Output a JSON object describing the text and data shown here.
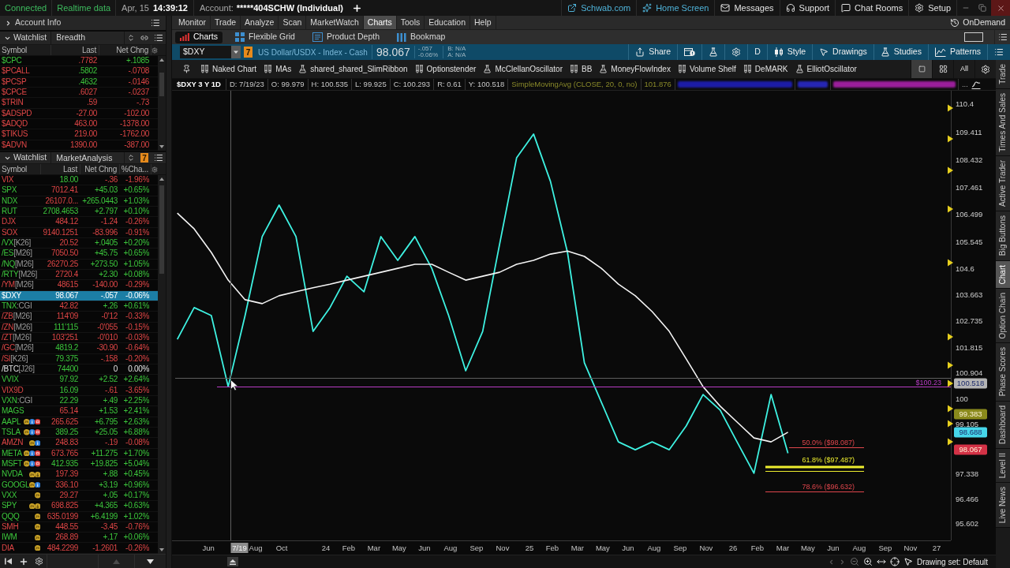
{
  "status_bar": {
    "connection": "Connected",
    "data_feed": "Realtime data",
    "date": "Apr, 15",
    "time": "14:39:12",
    "account_label": "Account:",
    "account": "*****404SCHW (Individual)"
  },
  "top_links": [
    {
      "label": "Schwab.com",
      "kind": "external",
      "accent": true
    },
    {
      "label": "Home Screen",
      "kind": "home",
      "accent": true
    },
    {
      "label": "Messages",
      "kind": "mail",
      "accent": false
    },
    {
      "label": "Support",
      "kind": "support",
      "accent": false
    },
    {
      "label": "Chat Rooms",
      "kind": "chat",
      "accent": false
    },
    {
      "label": "Setup",
      "kind": "setup",
      "accent": false
    }
  ],
  "account_info": {
    "label": "Account Info",
    "expanded": false
  },
  "watchlists": [
    {
      "title": "Watchlist",
      "name": "Breadth",
      "expanded": true,
      "columns": [
        "Symbol",
        "Last",
        "Net Chng"
      ],
      "rows": [
        {
          "symbol": "$CPC",
          "last": ".7782",
          "change": "+.1085",
          "up": true,
          "down": false,
          "last_up": false,
          "selected": false
        },
        {
          "symbol": "$PCALL",
          "last": ".5802",
          "change": "-.0708",
          "up": false,
          "down": true,
          "last_up": true,
          "selected": false
        },
        {
          "symbol": "$PCSP",
          "last": ".4632",
          "change": "-.0146",
          "up": false,
          "down": true,
          "last_up": true,
          "selected": false
        },
        {
          "symbol": "$CPCE",
          "last": ".6027",
          "change": "-.0237",
          "up": false,
          "down": true,
          "last_up": false,
          "selected": false
        },
        {
          "symbol": "$TRIN",
          "last": ".59",
          "change": "-.73",
          "up": false,
          "down": true,
          "last_up": false,
          "selected": false
        },
        {
          "symbol": "$ADSPD",
          "last": "-27.00",
          "change": "-102.00",
          "up": false,
          "down": true,
          "last_up": false,
          "selected": false
        },
        {
          "symbol": "$ADQD",
          "last": "463.00",
          "change": "-1378.00",
          "up": false,
          "down": true,
          "last_up": false,
          "selected": false
        },
        {
          "symbol": "$TIKUS",
          "last": "219.00",
          "change": "-1762.00",
          "up": false,
          "down": true,
          "last_up": false,
          "selected": false
        },
        {
          "symbol": "$ADVN",
          "last": "1390.00",
          "change": "-387.00",
          "up": false,
          "down": true,
          "last_up": false,
          "selected": false
        }
      ]
    },
    {
      "title": "Watchlist",
      "name": "MarketAnalysis",
      "expanded": true,
      "link_badge": "7",
      "columns": [
        "Symbol",
        "Last",
        "Net Chng",
        "%Cha..."
      ],
      "rows": [
        {
          "symbol": "VIX",
          "last": "18.00",
          "change": "-.36",
          "percent": "-1.96%",
          "up": false,
          "down": true,
          "last_up": true,
          "selected": false
        },
        {
          "symbol": "SPX",
          "last": "7012.41",
          "change": "+45.03",
          "percent": "+0.65%",
          "up": true,
          "down": false,
          "last_up": false,
          "selected": false
        },
        {
          "symbol": "NDX",
          "last": "26107.0...",
          "change": "+265.0443",
          "percent": "+1.03%",
          "up": true,
          "down": false,
          "last_up": false,
          "selected": false
        },
        {
          "symbol": "RUT",
          "last": "2708.4653",
          "change": "+2.797",
          "percent": "+0.10%",
          "up": true,
          "down": false,
          "last_up": true,
          "selected": false
        },
        {
          "symbol": "DJX",
          "last": "484.12",
          "change": "-1.24",
          "percent": "-0.26%",
          "up": false,
          "down": true,
          "last_up": false,
          "selected": false
        },
        {
          "symbol": "SOX",
          "last": "9140.1251",
          "change": "-83.996",
          "percent": "-0.91%",
          "up": false,
          "down": true,
          "last_up": false,
          "selected": false
        },
        {
          "symbol": "/VX",
          "suffix": "[K26]",
          "last": "20.52",
          "change": "+.0405",
          "percent": "+0.20%",
          "up": true,
          "down": false,
          "last_up": false,
          "selected": false
        },
        {
          "symbol": "/ES",
          "suffix": "[M26]",
          "last": "7050.50",
          "change": "+45.75",
          "percent": "+0.65%",
          "up": true,
          "down": false,
          "last_up": false,
          "selected": false
        },
        {
          "symbol": "/NQ",
          "suffix": "[M26]",
          "last": "26270.25",
          "change": "+273.50",
          "percent": "+1.05%",
          "up": true,
          "down": false,
          "last_up": false,
          "selected": false
        },
        {
          "symbol": "/RTY",
          "suffix": "[M26]",
          "last": "2720.4",
          "change": "+2.30",
          "percent": "+0.08%",
          "up": true,
          "down": false,
          "last_up": false,
          "selected": false
        },
        {
          "symbol": "/YM",
          "suffix": "[M26]",
          "last": "48615",
          "change": "-140.00",
          "percent": "-0.29%",
          "up": false,
          "down": true,
          "last_up": false,
          "selected": false
        },
        {
          "symbol": "$DXY",
          "last": "98.067",
          "change": "-.057",
          "percent": "-0.06%",
          "selected": true
        },
        {
          "symbol": "TNX",
          "suffix": ":CGI",
          "last": "42.82",
          "change": "+.26",
          "percent": "+0.61%",
          "up": true,
          "down": false,
          "last_up": false,
          "selected": false
        },
        {
          "symbol": "/ZB",
          "suffix": "[M26]",
          "last": "114'09",
          "change": "-0'12",
          "percent": "-0.33%",
          "up": false,
          "down": true,
          "last_up": false,
          "selected": false
        },
        {
          "symbol": "/ZN",
          "suffix": "[M26]",
          "last": "111'115",
          "change": "-0'055",
          "percent": "-0.15%",
          "up": false,
          "down": true,
          "last_up": true,
          "selected": false
        },
        {
          "symbol": "/ZT",
          "suffix": "[M26]",
          "last": "103'251",
          "change": "-0'010",
          "percent": "-0.03%",
          "up": false,
          "down": true,
          "last_up": false,
          "selected": false
        },
        {
          "symbol": "/GC",
          "suffix": "[M26]",
          "last": "4819.2",
          "change": "-30.90",
          "percent": "-0.64%",
          "up": false,
          "down": true,
          "last_up": true,
          "selected": false
        },
        {
          "symbol": "/SI",
          "suffix": "[K26]",
          "last": "79.375",
          "change": "-.158",
          "percent": "-0.20%",
          "up": false,
          "down": true,
          "last_up": true,
          "selected": false
        },
        {
          "symbol": "/BTC",
          "suffix": "[J26]",
          "last": "74400",
          "change": "0",
          "percent": "0.00%",
          "up": false,
          "down": false,
          "last_up": true,
          "selected": false
        },
        {
          "symbol": "VVIX",
          "last": "97.92",
          "change": "+2.52",
          "percent": "+2.64%",
          "up": true,
          "down": false,
          "last_up": true,
          "selected": false
        },
        {
          "symbol": "VIX9D",
          "last": "16.09",
          "change": "-.61",
          "percent": "-3.65%",
          "up": false,
          "down": true,
          "last_up": true,
          "selected": false
        },
        {
          "symbol": "VXN",
          "suffix": ":CGI",
          "last": "22.29",
          "change": "+.49",
          "percent": "+2.25%",
          "up": true,
          "down": false,
          "last_up": true,
          "selected": false
        },
        {
          "symbol": "MAGS",
          "last": "65.14",
          "change": "+1.53",
          "percent": "+2.41%",
          "up": true,
          "down": false,
          "last_up": false,
          "selected": false
        },
        {
          "symbol": "AAPL",
          "flags": [
            {
              "kind": "hours"
            },
            {
              "kind": "info"
            },
            {
              "kind": "alert"
            }
          ],
          "last": "265.625",
          "change": "+6.795",
          "percent": "+2.63%",
          "up": true,
          "down": false,
          "last_up": false,
          "selected": false
        },
        {
          "symbol": "TSLA",
          "flags": [
            {
              "kind": "hours"
            },
            {
              "kind": "info"
            },
            {
              "kind": "alert"
            }
          ],
          "last": "389.25",
          "change": "+25.05",
          "percent": "+6.88%",
          "up": true,
          "down": false,
          "last_up": true,
          "selected": false
        },
        {
          "symbol": "AMZN",
          "flags": [
            {
              "kind": "hours"
            },
            {
              "kind": "info"
            }
          ],
          "last": "248.83",
          "change": "-.19",
          "percent": "-0.08%",
          "up": false,
          "down": true,
          "last_up": false,
          "selected": false
        },
        {
          "symbol": "META",
          "flags": [
            {
              "kind": "hours"
            },
            {
              "kind": "info"
            },
            {
              "kind": "alert"
            }
          ],
          "last": "673.765",
          "change": "+11.275",
          "percent": "+1.70%",
          "up": true,
          "down": false,
          "last_up": false,
          "selected": false
        },
        {
          "symbol": "MSFT",
          "flags": [
            {
              "kind": "hours"
            },
            {
              "kind": "info"
            },
            {
              "kind": "alert"
            }
          ],
          "last": "412.935",
          "change": "+19.825",
          "percent": "+5.04%",
          "up": true,
          "down": false,
          "last_up": true,
          "selected": false
        },
        {
          "symbol": "NVDA",
          "flags": [
            {
              "kind": "hours"
            },
            {
              "kind": "arrow"
            }
          ],
          "last": "197.39",
          "change": "+.88",
          "percent": "+0.45%",
          "up": true,
          "down": false,
          "last_up": false,
          "selected": false
        },
        {
          "symbol": "GOOGL",
          "flags": [
            {
              "kind": "hours"
            },
            {
              "kind": "info"
            }
          ],
          "last": "336.10",
          "change": "+3.19",
          "percent": "+0.96%",
          "up": true,
          "down": false,
          "last_up": false,
          "selected": false
        },
        {
          "symbol": "VXX",
          "flags": [
            {
              "kind": "hours"
            }
          ],
          "last": "29.27",
          "change": "+.05",
          "percent": "+0.17%",
          "up": true,
          "down": false,
          "last_up": false,
          "selected": false
        },
        {
          "symbol": "SPY",
          "flags": [
            {
              "kind": "hours"
            },
            {
              "kind": "arrow"
            }
          ],
          "last": "698.825",
          "change": "+4.365",
          "percent": "+0.63%",
          "up": true,
          "down": false,
          "last_up": false,
          "selected": false
        },
        {
          "symbol": "QQQ",
          "flags": [
            {
              "kind": "hours"
            }
          ],
          "last": "635.0199",
          "change": "+6.4199",
          "percent": "+1.02%",
          "up": true,
          "down": false,
          "last_up": false,
          "selected": false
        },
        {
          "symbol": "SMH",
          "flags": [
            {
              "kind": "hours"
            }
          ],
          "last": "448.55",
          "change": "-3.45",
          "percent": "-0.76%",
          "up": false,
          "down": true,
          "last_up": false,
          "selected": false
        },
        {
          "symbol": "IWM",
          "flags": [
            {
              "kind": "hours"
            }
          ],
          "last": "268.89",
          "change": "+.17",
          "percent": "+0.06%",
          "up": true,
          "down": false,
          "last_up": false,
          "selected": false
        },
        {
          "symbol": "DIA",
          "flags": [
            {
              "kind": "hours"
            }
          ],
          "last": "484.2299",
          "change": "-1.2601",
          "percent": "-0.26%",
          "up": false,
          "down": true,
          "last_up": false,
          "selected": false
        }
      ]
    }
  ],
  "nav_tabs": [
    {
      "label": "Monitor",
      "selected": false
    },
    {
      "label": "Trade",
      "selected": false
    },
    {
      "label": "Analyze",
      "selected": false
    },
    {
      "label": "Scan",
      "selected": false
    },
    {
      "label": "MarketWatch",
      "selected": false
    },
    {
      "label": "Charts",
      "selected": true
    },
    {
      "label": "Tools",
      "selected": false
    },
    {
      "label": "Education",
      "selected": false
    },
    {
      "label": "Help",
      "selected": false
    }
  ],
  "on_demand": "OnDemand",
  "sub_tabs": [
    {
      "label": "Charts",
      "kind": "charts",
      "selected": true
    },
    {
      "label": "Flexible Grid",
      "kind": "grid",
      "selected": false
    },
    {
      "label": "Product Depth",
      "kind": "depth",
      "selected": false
    },
    {
      "label": "Bookmap",
      "kind": "bookmap",
      "selected": false
    }
  ],
  "symbol_bar": {
    "symbol": "$DXY",
    "link_badge": "7",
    "description": "US Dollar/USDX - Index - Cash",
    "price": "98.067",
    "change": "-.057",
    "change_percent": "-0.06%",
    "bid": "B: N/A",
    "ask": "A: N/A",
    "tools": [
      {
        "kind": "share",
        "label": "Share"
      },
      {
        "kind": "alert"
      },
      {
        "kind": "flask"
      },
      {
        "kind": "settings"
      },
      {
        "kind": "aggregation",
        "label": "D"
      },
      {
        "kind": "style",
        "label": "Style"
      },
      {
        "kind": "drawings",
        "label": "Drawings"
      },
      {
        "kind": "studies",
        "label": "Studies"
      },
      {
        "kind": "patterns",
        "label": "Patterns"
      },
      {
        "kind": "menu"
      }
    ]
  },
  "study_bar": {
    "items": [
      {
        "label": "Naked Chart",
        "kind": "set"
      },
      {
        "label": "MAs",
        "kind": "set"
      },
      {
        "label": "shared_shared_SlimRibbon",
        "kind": "study"
      },
      {
        "label": "Optionstender",
        "kind": "set"
      },
      {
        "label": "McClellanOscillator",
        "kind": "study"
      },
      {
        "label": "BB",
        "kind": "set"
      },
      {
        "label": "MoneyFlowIndex",
        "kind": "study"
      },
      {
        "label": "Volume Shelf",
        "kind": "set"
      },
      {
        "label": "DeMARK",
        "kind": "set"
      },
      {
        "label": "ElliotOscillator",
        "kind": "study"
      }
    ],
    "layouts": [
      {
        "kind": "single",
        "selected": true
      },
      {
        "kind": "grid",
        "selected": false
      },
      {
        "kind": "all",
        "label": "All",
        "selected": false
      }
    ]
  },
  "chart_header": {
    "title": "$DXY 3 Y 1D",
    "values": [
      "D: 7/19/23",
      "O: 99.979",
      "H: 100.535",
      "L: 99.925",
      "C: 100.293",
      "R: 0.61",
      "Y: 100.518"
    ],
    "studies": [
      {
        "kind": "study",
        "label": "SimpleMovingAvg (CLOSE, 20, 0, no)"
      },
      {
        "kind": "study",
        "label": "101.876"
      },
      {
        "kind": "blurred",
        "color": "#1c1ca6"
      },
      {
        "kind": "blurred",
        "color": "#2626b4"
      },
      {
        "kind": "blurred",
        "color": "#9a1e9a"
      },
      {
        "kind": "more",
        "label": "..."
      }
    ]
  },
  "chart": {
    "chart_data": {
      "type": "line",
      "x": [
        23.27,
        23.353,
        23.437,
        23.52,
        23.603,
        23.687,
        23.77,
        23.853,
        23.937,
        24.02,
        24.103,
        24.187,
        24.27,
        24.353,
        24.437,
        24.52,
        24.603,
        24.687,
        24.77,
        24.853,
        24.937,
        25.02,
        25.103,
        25.187,
        25.27,
        25.353,
        25.437,
        25.52,
        25.603,
        25.687,
        25.77,
        25.853,
        25.937,
        26.02,
        26.103,
        26.187,
        26.27
      ],
      "xlim": [
        23.244,
        27.291
      ],
      "ylim": [
        94.99,
        110.87
      ],
      "xticks": [
        {
          "value": 23.4225,
          "label": "Jun"
        },
        {
          "value": 23.655,
          "label": "Aug"
        },
        {
          "value": 23.783,
          "label": "Oct"
        },
        {
          "value": 24,
          "label": "24"
        },
        {
          "value": 24.112,
          "label": "Feb"
        },
        {
          "value": 24.236,
          "label": "Mar"
        },
        {
          "value": 24.36,
          "label": "May"
        },
        {
          "value": 24.484,
          "label": "Jun"
        },
        {
          "value": 24.612,
          "label": "Aug"
        },
        {
          "value": 24.74,
          "label": "Sep"
        },
        {
          "value": 24.868,
          "label": "Nov"
        },
        {
          "value": 25,
          "label": "25"
        },
        {
          "value": 25.112,
          "label": "Feb"
        },
        {
          "value": 25.236,
          "label": "Mar"
        },
        {
          "value": 25.36,
          "label": "May"
        },
        {
          "value": 25.484,
          "label": "Jun"
        },
        {
          "value": 25.612,
          "label": "Aug"
        },
        {
          "value": 25.74,
          "label": "Sep"
        },
        {
          "value": 25.868,
          "label": "Nov"
        },
        {
          "value": 26,
          "label": "26"
        },
        {
          "value": 26.12,
          "label": "Feb"
        },
        {
          "value": 26.244,
          "label": "Mar"
        },
        {
          "value": 26.368,
          "label": "May"
        },
        {
          "value": 26.492,
          "label": "Jun"
        },
        {
          "value": 26.62,
          "label": "Aug"
        },
        {
          "value": 26.748,
          "label": "Sep"
        },
        {
          "value": 26.872,
          "label": "Nov"
        },
        {
          "value": 27,
          "label": "27"
        }
      ],
      "yticks": [
        95.602,
        96.466,
        97.338,
        99.105,
        100,
        100.904,
        101.815,
        102.735,
        103.663,
        104.6,
        105.545,
        106.499,
        107.461,
        108.432,
        109.411,
        110.4
      ],
      "series": [
        {
          "color": "#3ef2e2",
          "values": [
            102.09,
            103.21,
            102.93,
            100.42,
            102.93,
            105.72,
            106.83,
            105.72,
            102.37,
            103.21,
            104.32,
            103.77,
            105.72,
            104.88,
            105.72,
            104.6,
            102.93,
            100.98,
            102.37,
            105.44,
            108.5,
            109.34,
            107.67,
            105.16,
            101.26,
            99.87,
            98.47,
            98.19,
            98.47,
            98.19,
            99.03,
            100.14,
            99.59,
            98.47,
            97.36,
            100.14,
            98.07
          ]
        },
        {
          "color": "#f4f4f4",
          "values": [
            106.55,
            105.99,
            105.16,
            104.18,
            103.49,
            103.35,
            103.63,
            103.77,
            103.91,
            104.04,
            104.18,
            104.32,
            104.46,
            104.6,
            104.74,
            104.74,
            104.46,
            104.18,
            104.32,
            104.46,
            104.74,
            104.88,
            105.1,
            105.21,
            105.02,
            104.6,
            104.04,
            103.63,
            103.07,
            102.37,
            101.4,
            100.42,
            99.73,
            99.17,
            98.61,
            98.47,
            98.81
          ]
        }
      ]
    },
    "crosshair_date": "7/19",
    "drawings": [
      {
        "text": "$100.23",
        "color": "#b83cc4"
      },
      {
        "text": "50.0% ($98.087)",
        "color": "#e0464c"
      },
      {
        "text": "61.8% ($97.487)",
        "color": "#eeee2e"
      },
      {
        "text": "78.6% ($96.632)",
        "color": "#e0464c"
      }
    ],
    "price_badges": [
      {
        "text": "100.518",
        "color": "#b4b4b4"
      },
      {
        "text": "99.383",
        "color": "#8a8a1c"
      },
      {
        "text": "98.688",
        "color": "#46d6ea"
      },
      {
        "text": "98.067",
        "color": "#d43246"
      }
    ]
  },
  "drawing_set": "Drawing set: Default",
  "side_tabs": [
    {
      "label": "Trade",
      "selected": false
    },
    {
      "label": "Times And Sales",
      "selected": false
    },
    {
      "label": "Active Trader",
      "selected": false
    },
    {
      "label": "Big Buttons",
      "selected": false
    },
    {
      "label": "Chart",
      "selected": true
    },
    {
      "label": "Option Chain",
      "selected": false
    },
    {
      "label": "Phase Scores",
      "selected": false
    },
    {
      "label": "Dashboard",
      "selected": false
    },
    {
      "label": "Level II",
      "selected": false
    },
    {
      "label": "Live News",
      "selected": false
    }
  ]
}
